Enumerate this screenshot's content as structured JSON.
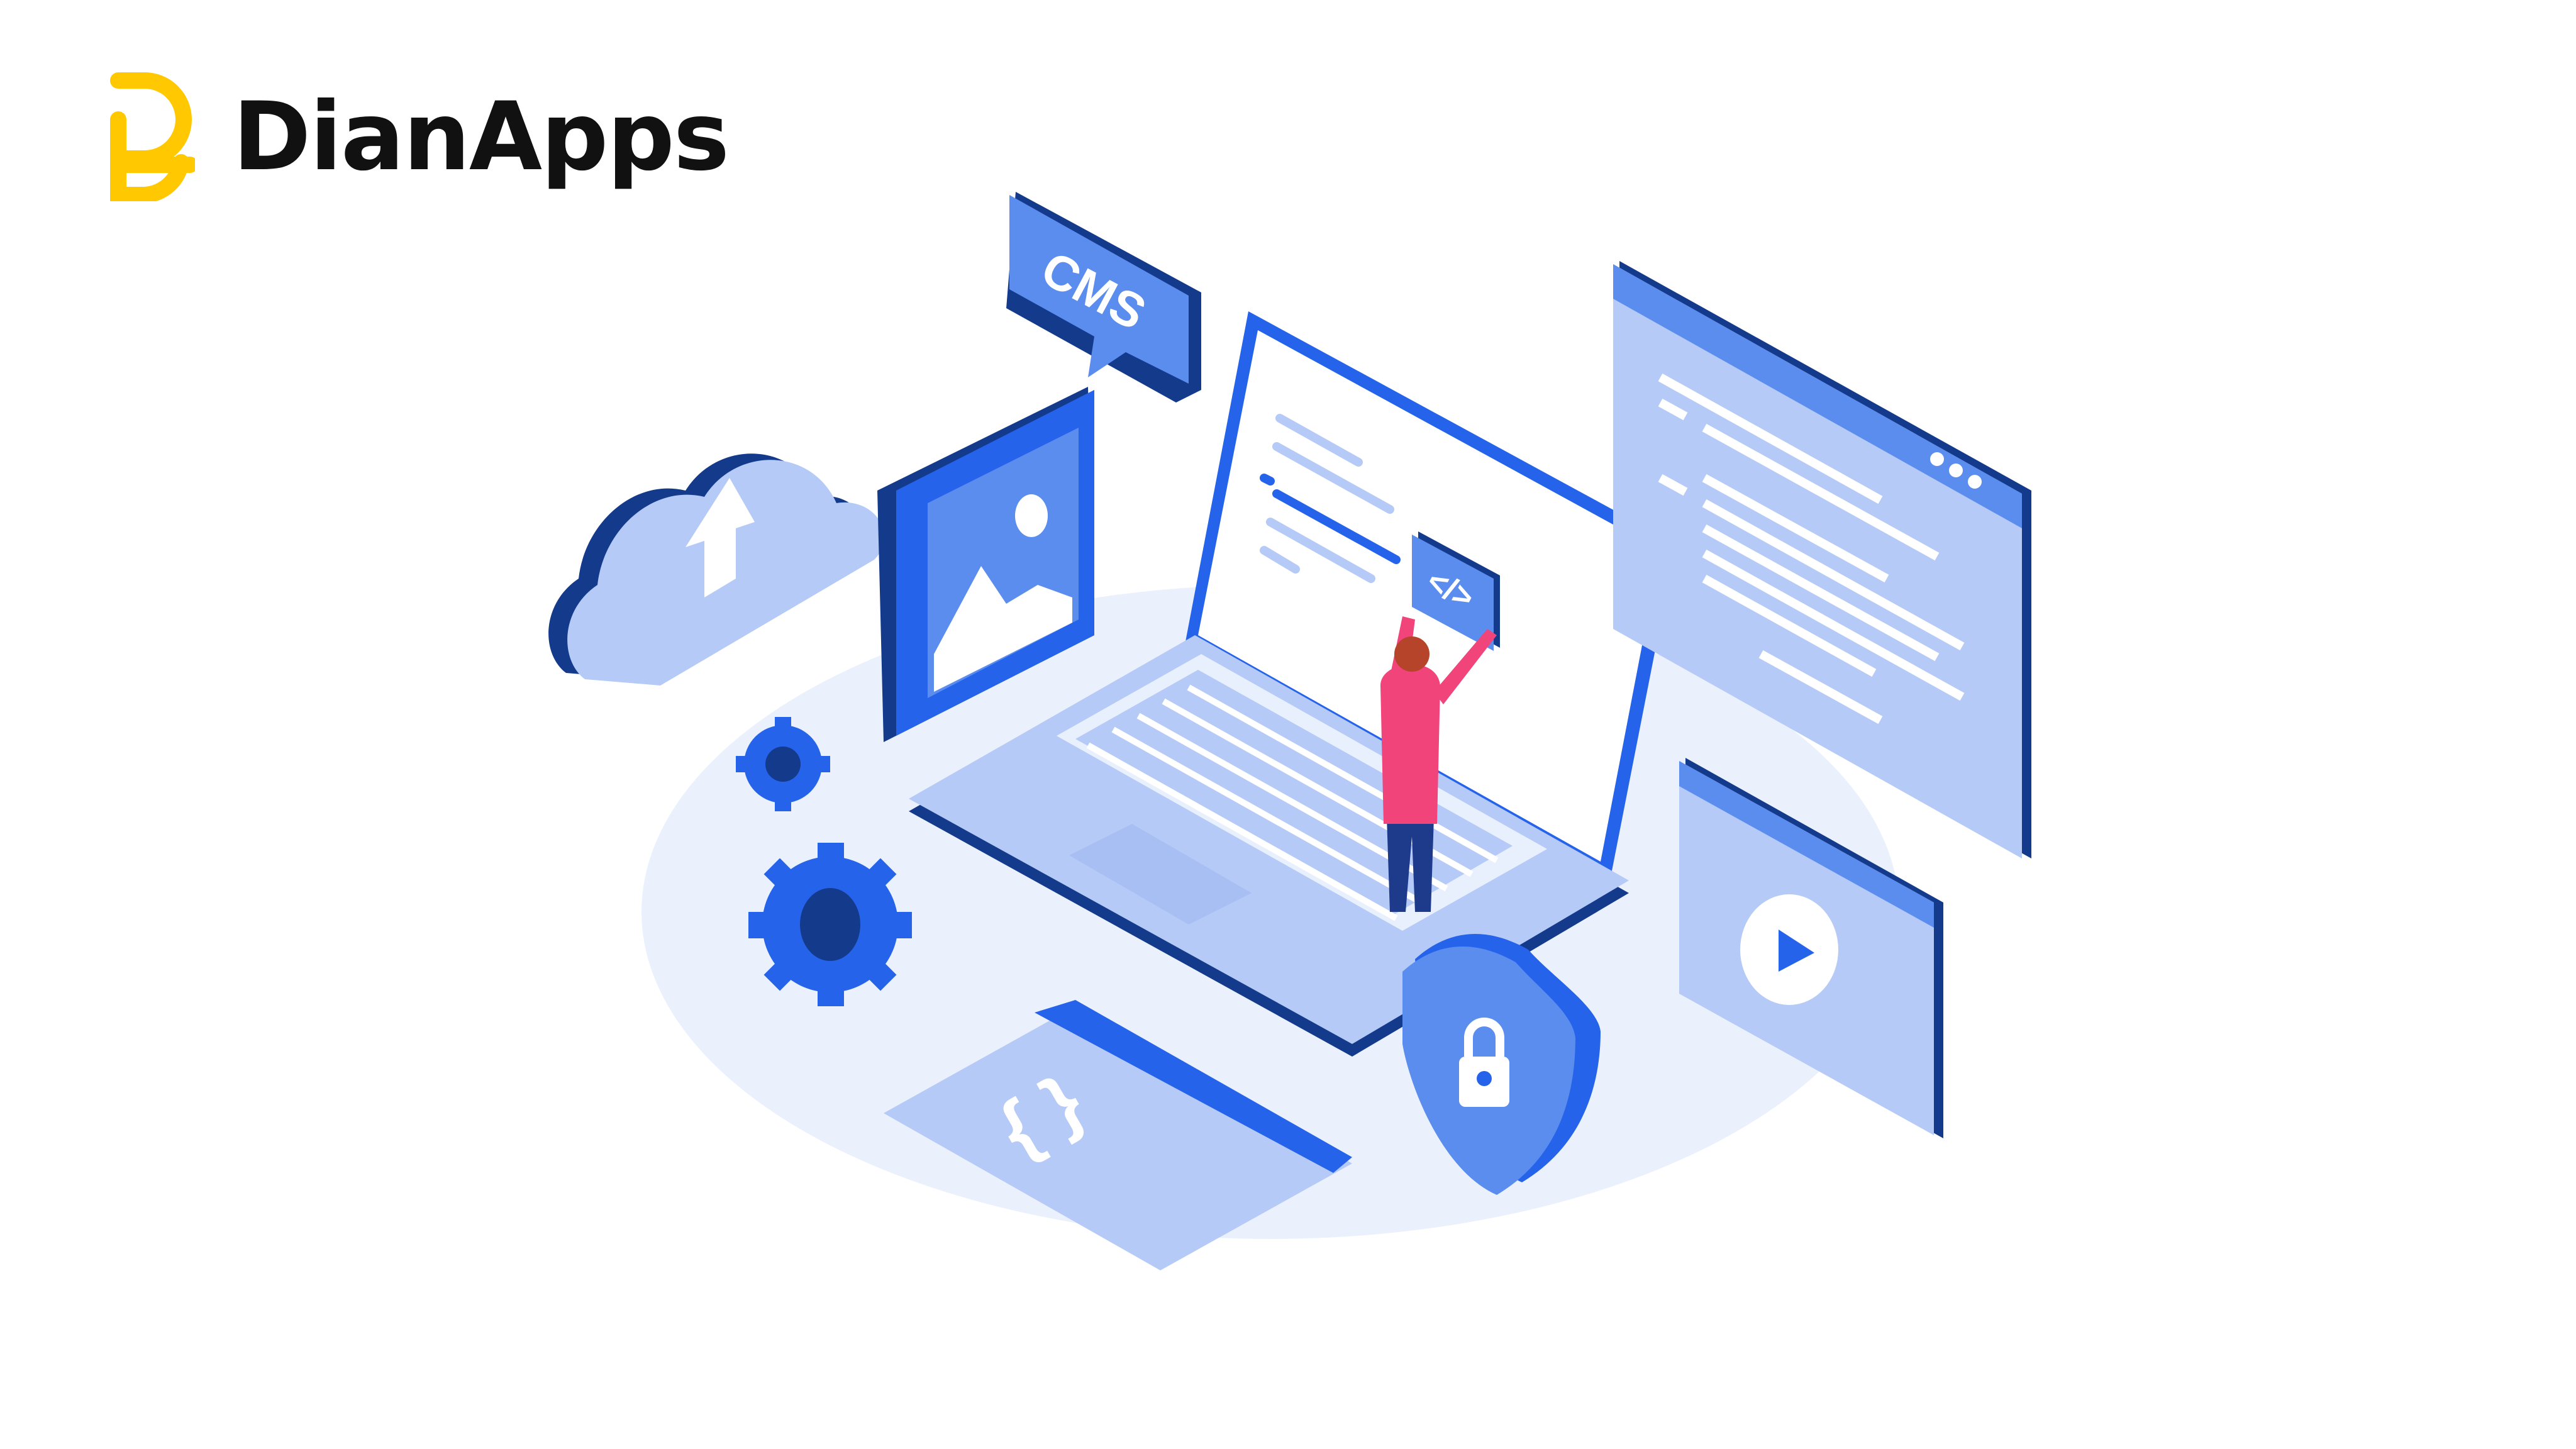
{
  "brand": {
    "name": "DianApps",
    "mark_color": "#FFC800",
    "text_color": "#111111"
  },
  "illustration": {
    "cms_bubble_label": "CMS",
    "code_tag_label": "</>",
    "braces_label": "{ }",
    "colors": {
      "primary_blue": "#2563EB",
      "mid_blue": "#5B8DEF",
      "light_blue": "#B5CAF6",
      "pale_blue": "#E8F0FD",
      "dark_blue": "#143A8C",
      "person_shirt": "#F0447A",
      "person_pants": "#1E3A8A"
    },
    "icons": [
      "cloud-upload-icon",
      "image-icon",
      "cms-chat-icon",
      "gear-icon",
      "code-tag-icon",
      "curly-braces-icon",
      "shield-lock-icon",
      "browser-window-icon",
      "video-play-icon",
      "laptop-icon",
      "person-figure"
    ]
  }
}
